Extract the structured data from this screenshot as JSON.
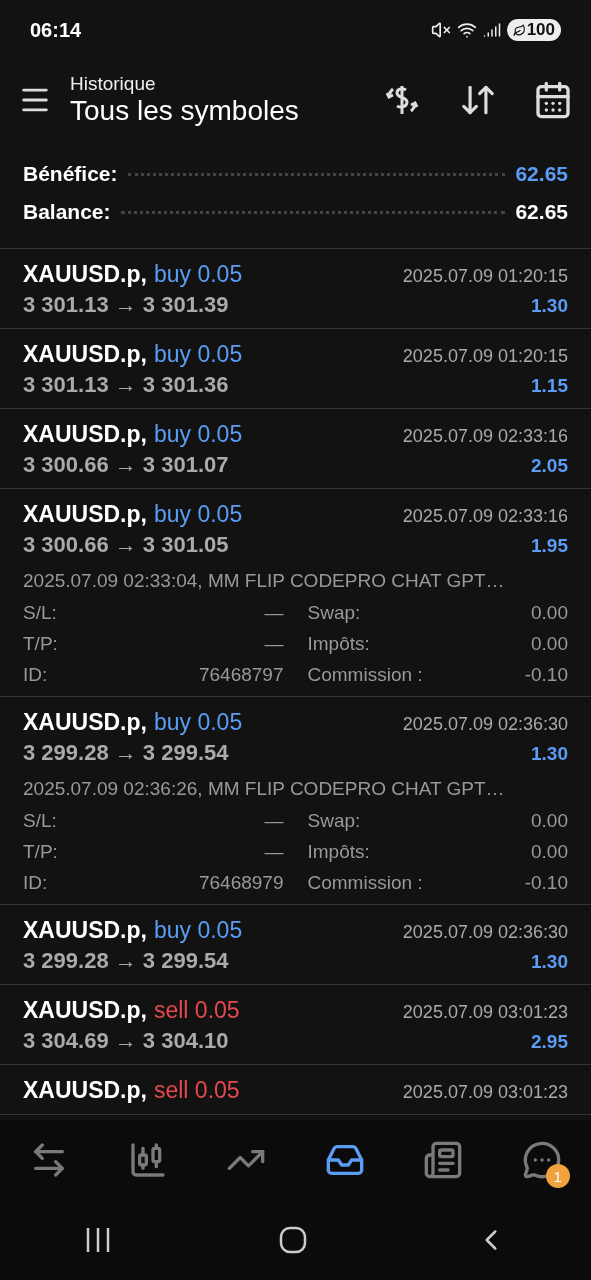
{
  "status_bar": {
    "time": "06:14",
    "battery": "100"
  },
  "header": {
    "subtitle": "Historique",
    "title": "Tous les symboles"
  },
  "summary": [
    {
      "label": "Bénéfice:",
      "value": "62.65",
      "kind": "accent"
    },
    {
      "label": "Balance:",
      "value": "62.65",
      "kind": "plain"
    }
  ],
  "trades": [
    {
      "symbol": "XAUUSD.p,",
      "order": "buy 0.05",
      "kind": "buy",
      "prices": "3 301.13 → 3 301.39",
      "time": "2025.07.09 01:20:15",
      "profit": "1.30",
      "expanded": false
    },
    {
      "symbol": "XAUUSD.p,",
      "order": "buy 0.05",
      "kind": "buy",
      "prices": "3 301.13 → 3 301.36",
      "time": "2025.07.09 01:20:15",
      "profit": "1.15",
      "expanded": false
    },
    {
      "symbol": "XAUUSD.p,",
      "order": "buy 0.05",
      "kind": "buy",
      "prices": "3 300.66 → 3 301.07",
      "time": "2025.07.09 02:33:16",
      "profit": "2.05",
      "expanded": false
    },
    {
      "symbol": "XAUUSD.p,",
      "order": "buy 0.05",
      "kind": "buy",
      "prices": "3 300.66 → 3 301.05",
      "time": "2025.07.09 02:33:16",
      "profit": "1.95",
      "expanded": true,
      "comment": "2025.07.09 02:33:04, MM FLIP CODEPRO CHAT GPT…",
      "details": [
        [
          "S/L:",
          "—",
          "Swap:",
          "0.00"
        ],
        [
          "T/P:",
          "—",
          "Impôts:",
          "0.00"
        ],
        [
          "ID:",
          "76468797",
          "Commission :",
          "-0.10"
        ]
      ]
    },
    {
      "symbol": "XAUUSD.p,",
      "order": "buy 0.05",
      "kind": "buy",
      "prices": "3 299.28 → 3 299.54",
      "time": "2025.07.09 02:36:30",
      "profit": "1.30",
      "expanded": true,
      "comment": "2025.07.09 02:36:26, MM FLIP CODEPRO CHAT GPT…",
      "details": [
        [
          "S/L:",
          "—",
          "Swap:",
          "0.00"
        ],
        [
          "T/P:",
          "—",
          "Impôts:",
          "0.00"
        ],
        [
          "ID:",
          "76468979",
          "Commission :",
          "-0.10"
        ]
      ]
    },
    {
      "symbol": "XAUUSD.p,",
      "order": "buy 0.05",
      "kind": "buy",
      "prices": "3 299.28 → 3 299.54",
      "time": "2025.07.09 02:36:30",
      "profit": "1.30",
      "expanded": false
    },
    {
      "symbol": "XAUUSD.p,",
      "order": "sell 0.05",
      "kind": "sell",
      "prices": "3 304.69 → 3 304.10",
      "time": "2025.07.09 03:01:23",
      "profit": "2.95",
      "expanded": false
    },
    {
      "symbol": "XAUUSD.p,",
      "order": "sell 0.05",
      "kind": "sell",
      "time": "2025.07.09 03:01:23",
      "expanded": false
    }
  ],
  "bottom_nav": [
    {
      "kind": "quotes",
      "selected": false
    },
    {
      "kind": "chart",
      "selected": false
    },
    {
      "kind": "trade",
      "selected": false
    },
    {
      "kind": "history",
      "selected": true
    },
    {
      "kind": "news",
      "selected": false
    },
    {
      "kind": "chat",
      "selected": false,
      "badge": "1"
    }
  ]
}
